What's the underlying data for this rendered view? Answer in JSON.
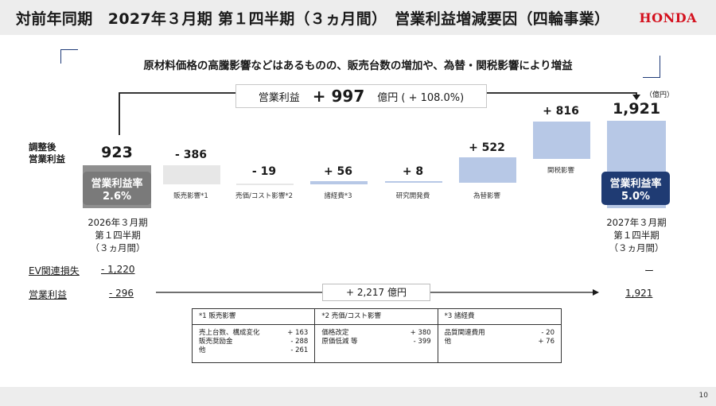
{
  "header": {
    "title": "対前年同期　2027年３月期 第１四半期（３ヵ月間）　営業利益増減要因（四輪事業）",
    "logo": "HONDA"
  },
  "summary": "原材料価格の高騰影響などはあるものの、販売台数の増加や、為替・関税影響により増益",
  "total": {
    "label": "営業利益",
    "value": "+ 997",
    "unit": "億円 ( + 108.0%)"
  },
  "unit_note": "（億円）",
  "side_label": {
    "line1": "調整後",
    "line2": "営業利益"
  },
  "waterfall": {
    "start": {
      "value": "923",
      "rate_title": "営業利益率",
      "rate": "2.6%",
      "period": [
        "2026年３月期",
        "第１四半期",
        "（３ヵ月間）"
      ]
    },
    "end": {
      "value": "1,921",
      "rate_title": "営業利益率",
      "rate": "5.0%",
      "period": [
        "2027年３月期",
        "第１四半期",
        "（３ヵ月間）"
      ]
    },
    "factors": [
      {
        "label": "販売影響*1",
        "value": "- 386"
      },
      {
        "label": "売価/コスト影響*2",
        "value": "- 19"
      },
      {
        "label": "諸経費*3",
        "value": "+ 56"
      },
      {
        "label": "研究開発費",
        "value": "+ 8"
      },
      {
        "label": "為替影響",
        "value": "+ 522"
      },
      {
        "label": "関税影響",
        "value": "+ 816"
      }
    ]
  },
  "chart_data": {
    "type": "bar",
    "title": "",
    "categories": [
      "2026年３月期 第１四半期",
      "販売影響",
      "売価/コスト影響",
      "諸経費",
      "研究開発費",
      "為替影響",
      "関税影響",
      "2027年３月期 第１四半期"
    ],
    "values": [
      923,
      -386,
      -19,
      56,
      8,
      522,
      816,
      1921
    ],
    "ylabel": "億円"
  },
  "ev_row": {
    "label": "EV関連損失",
    "start": "- 1,220",
    "end": "ー"
  },
  "op_row": {
    "label": "営業利益",
    "start": "- 296",
    "end": "1,921",
    "diff": "+ 2,217 億円"
  },
  "notes": [
    {
      "title": "*1 販売影響",
      "items": [
        {
          "name": "売上台数、構成変化",
          "value": "+ 163"
        },
        {
          "name": "販売奨励金",
          "value": "- 288"
        },
        {
          "name": "他",
          "value": "- 261"
        }
      ]
    },
    {
      "title": "*2 売価/コスト影響",
      "items": [
        {
          "name": "価格改定",
          "value": "+ 380"
        },
        {
          "name": "原価低減 等",
          "value": "- 399"
        }
      ]
    },
    {
      "title": "*3 諸経費",
      "items": [
        {
          "name": "品質関連費用",
          "value": "- 20"
        },
        {
          "name": "他",
          "value": "+ 76"
        }
      ]
    }
  ],
  "page_number": "10",
  "colors": {
    "start_bar": "#8f8f8f",
    "end_bar": "#b7c8e6",
    "increase": "#b7c8e6",
    "decrease": "#e7e7e7",
    "start_rate": "#7a7a7a",
    "end_rate": "#1f3b73",
    "brand": "#d4111e"
  }
}
